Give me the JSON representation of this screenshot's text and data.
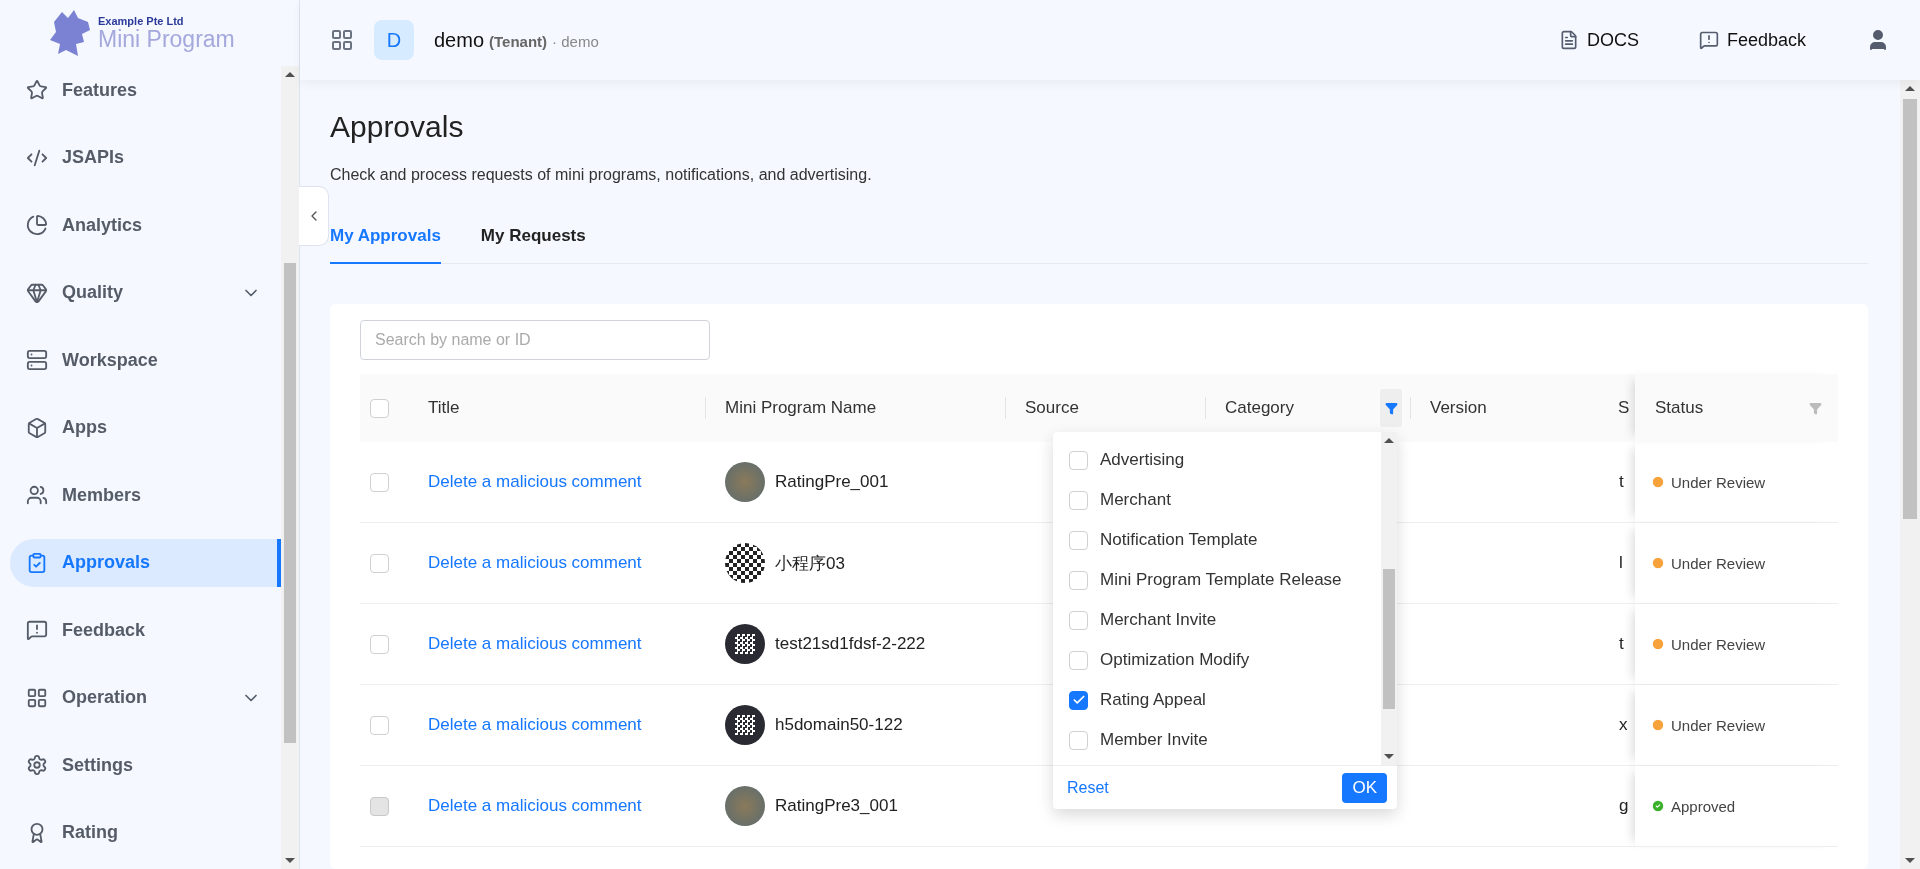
{
  "brand": {
    "company": "Example Pte Ltd",
    "product": "Mini Program"
  },
  "sidebar": {
    "items": [
      {
        "label": "Features",
        "kind": "link",
        "selected": false
      },
      {
        "label": "JSAPIs",
        "kind": "link",
        "selected": false
      },
      {
        "label": "Analytics",
        "kind": "link",
        "selected": false
      },
      {
        "label": "Quality",
        "kind": "group",
        "selected": false
      },
      {
        "label": "Workspace",
        "kind": "link",
        "selected": false
      },
      {
        "label": "Apps",
        "kind": "link",
        "selected": false
      },
      {
        "label": "Members",
        "kind": "link",
        "selected": false
      },
      {
        "label": "Approvals",
        "kind": "link",
        "selected": true
      },
      {
        "label": "Feedback",
        "kind": "link",
        "selected": false
      },
      {
        "label": "Operation",
        "kind": "group",
        "selected": false
      },
      {
        "label": "Settings",
        "kind": "link",
        "selected": false
      },
      {
        "label": "Rating",
        "kind": "link",
        "selected": false
      }
    ]
  },
  "header": {
    "tenant_initial": "D",
    "tenant_name": "demo",
    "tenant_type": "(Tenant)",
    "tenant_suffix": "· demo",
    "links": [
      "DOCS",
      "Feedback"
    ]
  },
  "page": {
    "title": "Approvals",
    "description": "Check and process requests of mini programs, notifications, and advertising.",
    "tabs": [
      {
        "label": "My Approvals",
        "selected": true
      },
      {
        "label": "My Requests",
        "selected": false
      }
    ]
  },
  "search": {
    "placeholder": "Search by name or ID"
  },
  "table": {
    "select_all": {
      "checked": false
    },
    "columns": [
      "Title",
      "Mini Program Name",
      "Source",
      "Category",
      "Version",
      "S",
      "Status"
    ],
    "rows": [
      {
        "checked": false,
        "disabled": false,
        "title": "Delete a malicious comment",
        "kind": "photo",
        "name": "RatingPre_001",
        "column_6": "t",
        "status": {
          "label": "Under Review",
          "kind": "pending"
        }
      },
      {
        "checked": false,
        "disabled": false,
        "title": "Delete a malicious comment",
        "kind": "qr",
        "name": "小程序03",
        "column_6": "l",
        "status": {
          "label": "Under Review",
          "kind": "pending"
        }
      },
      {
        "checked": false,
        "disabled": false,
        "title": "Delete a malicious comment",
        "kind": "qr-dark",
        "name": "test21sd1fdsf-2-222",
        "column_6": "t",
        "status": {
          "label": "Under Review",
          "kind": "pending"
        }
      },
      {
        "checked": false,
        "disabled": false,
        "title": "Delete a malicious comment",
        "kind": "qr-dark",
        "name": "h5domain50-122",
        "column_6": "x",
        "status": {
          "label": "Under Review",
          "kind": "pending"
        }
      },
      {
        "checked": false,
        "disabled": true,
        "title": "Delete a malicious comment",
        "kind": "photo",
        "name": "RatingPre3_001",
        "column_6": "g",
        "status": {
          "label": "Approved",
          "kind": "approved"
        }
      }
    ]
  },
  "category_filter": {
    "options": [
      {
        "label": "Advertising",
        "checked": false
      },
      {
        "label": "Merchant",
        "checked": false
      },
      {
        "label": "Notification Template",
        "checked": false
      },
      {
        "label": "Mini Program Template Release",
        "checked": false
      },
      {
        "label": "Merchant Invite",
        "checked": false
      },
      {
        "label": "Optimization Modify",
        "checked": false
      },
      {
        "label": "Rating Appeal",
        "checked": true
      },
      {
        "label": "Member Invite",
        "checked": false
      }
    ],
    "reset": "Reset",
    "ok": "OK"
  }
}
